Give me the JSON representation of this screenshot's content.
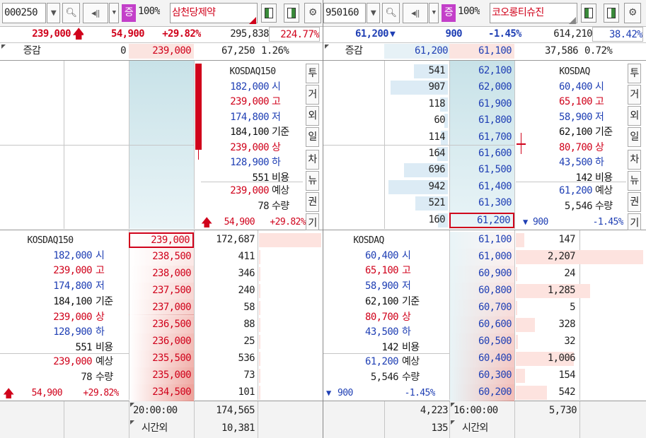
{
  "left": {
    "toolbar": {
      "code": "000250",
      "name": "삼천당제약",
      "zoom": "100%",
      "badge": "증"
    },
    "summary": {
      "price": "239,000",
      "change": "54,900",
      "rate": "+29.82%",
      "volume": "295,838",
      "vol_ratio": "224.77%"
    },
    "delta_row": {
      "label": "증감",
      "sell_delta": "0",
      "price": "239,000",
      "buy_delta": "67,250",
      "ratio": "1.26%"
    },
    "info_top": {
      "index": "KOSDAQ150",
      "rows": [
        {
          "val": "182,000",
          "lbl": "시",
          "color": "blue"
        },
        {
          "val": "239,000",
          "lbl": "고",
          "color": "red"
        },
        {
          "val": "174,800",
          "lbl": "저",
          "color": "blue"
        },
        {
          "val": "184,100",
          "lbl": "기준",
          "color": "blk"
        },
        {
          "val": "239,000",
          "lbl": "상",
          "color": "red"
        },
        {
          "val": "128,900",
          "lbl": "하",
          "color": "blue"
        },
        {
          "val": "551",
          "lbl": "비용",
          "color": "blk"
        }
      ],
      "expect": {
        "val": "239,000",
        "lbl": "예상"
      },
      "qty": {
        "val": "78",
        "lbl": "수량"
      },
      "chg": {
        "val": "54,900",
        "rate": "+29.82%"
      }
    },
    "side_buttons": [
      "투",
      "거",
      "외",
      "일",
      "차",
      "뉴",
      "권",
      "기"
    ],
    "bids": [
      {
        "price": "239,000",
        "qty": "172,687"
      },
      {
        "price": "238,500",
        "qty": "411"
      },
      {
        "price": "238,000",
        "qty": "346"
      },
      {
        "price": "237,500",
        "qty": "240"
      },
      {
        "price": "237,000",
        "qty": "58"
      },
      {
        "price": "236,500",
        "qty": "88"
      },
      {
        "price": "236,000",
        "qty": "25"
      },
      {
        "price": "235,500",
        "qty": "536"
      },
      {
        "price": "235,000",
        "qty": "73"
      },
      {
        "price": "234,500",
        "qty": "101"
      }
    ],
    "bid_levels": [
      1.0,
      0.0024,
      0.002,
      0.0014,
      0.0003,
      0.0005,
      0.0001,
      0.0031,
      0.0004,
      0.0006
    ],
    "footer": {
      "time": "20:00:00",
      "total": "174,565",
      "label": "시간외",
      "after": "10,381"
    }
  },
  "right": {
    "toolbar": {
      "code": "950160",
      "name": "코오롱티슈진",
      "zoom": "100%",
      "badge": "증"
    },
    "summary": {
      "price": "61,200",
      "change": "900",
      "rate": "-1.45%",
      "volume": "614,210",
      "vol_ratio": "38.42%"
    },
    "delta_row": {
      "label": "증감",
      "sell_delta": "61,200",
      "price": "61,100",
      "buy_delta": "37,586",
      "ratio": "0.72%"
    },
    "asks": [
      {
        "qty": "541",
        "price": "62,100"
      },
      {
        "qty": "907",
        "price": "62,000"
      },
      {
        "qty": "118",
        "price": "61,900"
      },
      {
        "qty": "60",
        "price": "61,800"
      },
      {
        "qty": "114",
        "price": "61,700"
      },
      {
        "qty": "164",
        "price": "61,600"
      },
      {
        "qty": "696",
        "price": "61,500"
      },
      {
        "qty": "942",
        "price": "61,400"
      },
      {
        "qty": "521",
        "price": "61,300"
      },
      {
        "qty": "160",
        "price": "61,200"
      }
    ],
    "ask_levels": [
      0.574,
      0.963,
      0.125,
      0.064,
      0.121,
      0.174,
      0.739,
      1.0,
      0.553,
      0.17
    ],
    "info": {
      "index": "KOSDAQ",
      "rows": [
        {
          "val": "60,400",
          "lbl": "시",
          "color": "blue"
        },
        {
          "val": "65,100",
          "lbl": "고",
          "color": "red"
        },
        {
          "val": "58,900",
          "lbl": "저",
          "color": "blue"
        },
        {
          "val": "62,100",
          "lbl": "기준",
          "color": "blk"
        },
        {
          "val": "80,700",
          "lbl": "상",
          "color": "red"
        },
        {
          "val": "43,500",
          "lbl": "하",
          "color": "blue"
        },
        {
          "val": "142",
          "lbl": "비용",
          "color": "blk"
        }
      ],
      "expect": {
        "val": "61,200",
        "lbl": "예상"
      },
      "qty": {
        "val": "5,546",
        "lbl": "수량"
      },
      "chg": {
        "val": "900",
        "rate": "-1.45%"
      }
    },
    "side_buttons": [
      "투",
      "거",
      "외",
      "일",
      "차",
      "뉴",
      "권",
      "기"
    ],
    "bids": [
      {
        "price": "61,100",
        "qty": "147"
      },
      {
        "price": "61,000",
        "qty": "2,207"
      },
      {
        "price": "60,900",
        "qty": "24"
      },
      {
        "price": "60,800",
        "qty": "1,285"
      },
      {
        "price": "60,700",
        "qty": "5"
      },
      {
        "price": "60,600",
        "qty": "328"
      },
      {
        "price": "60,500",
        "qty": "32"
      },
      {
        "price": "60,400",
        "qty": "1,006"
      },
      {
        "price": "60,300",
        "qty": "154"
      },
      {
        "price": "60,200",
        "qty": "542"
      }
    ],
    "bid_levels": [
      0.067,
      1.0,
      0.011,
      0.582,
      0.002,
      0.149,
      0.015,
      0.456,
      0.07,
      0.246
    ],
    "footer": {
      "ask_total": "4,223",
      "time": "16:00:00",
      "bid_total": "5,730",
      "after_ask": "135",
      "label": "시간외"
    }
  }
}
